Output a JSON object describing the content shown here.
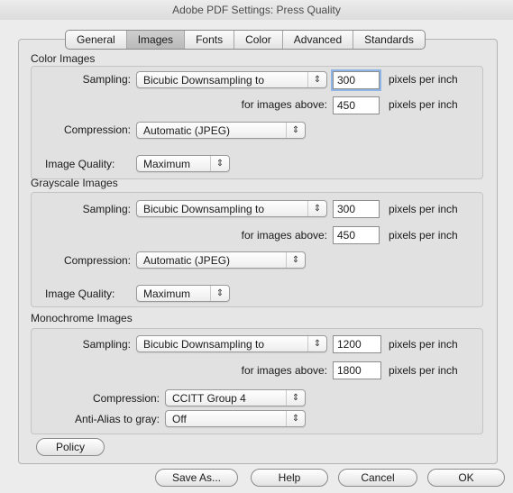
{
  "window": {
    "title": "Adobe PDF Settings: Press Quality"
  },
  "tabs": [
    {
      "label": "General"
    },
    {
      "label": "Images"
    },
    {
      "label": "Fonts"
    },
    {
      "label": "Color"
    },
    {
      "label": "Advanced"
    },
    {
      "label": "Standards"
    }
  ],
  "active_tab": "Images",
  "color_images": {
    "title": "Color Images",
    "sampling_label": "Sampling:",
    "sampling_value": "Bicubic Downsampling to",
    "ppi_value": "300",
    "ppi_unit": "pixels per inch",
    "above_label": "for images above:",
    "above_value": "450",
    "above_unit": "pixels per inch",
    "compression_label": "Compression:",
    "compression_value": "Automatic (JPEG)",
    "quality_label": "Image Quality:",
    "quality_value": "Maximum"
  },
  "grayscale_images": {
    "title": "Grayscale Images",
    "sampling_label": "Sampling:",
    "sampling_value": "Bicubic Downsampling to",
    "ppi_value": "300",
    "ppi_unit": "pixels per inch",
    "above_label": "for images above:",
    "above_value": "450",
    "above_unit": "pixels per inch",
    "compression_label": "Compression:",
    "compression_value": "Automatic (JPEG)",
    "quality_label": "Image Quality:",
    "quality_value": "Maximum"
  },
  "monochrome_images": {
    "title": "Monochrome Images",
    "sampling_label": "Sampling:",
    "sampling_value": "Bicubic Downsampling to",
    "ppi_value": "1200",
    "ppi_unit": "pixels per inch",
    "above_label": "for images above:",
    "above_value": "1800",
    "above_unit": "pixels per inch",
    "compression_label": "Compression:",
    "compression_value": "CCITT Group 4",
    "antialias_label": "Anti-Alias to gray:",
    "antialias_value": "Off"
  },
  "buttons": {
    "policy": "Policy",
    "save_as": "Save As...",
    "help": "Help",
    "cancel": "Cancel",
    "ok": "OK"
  },
  "icons": {
    "popup_arrows": "updown-arrows-icon"
  }
}
